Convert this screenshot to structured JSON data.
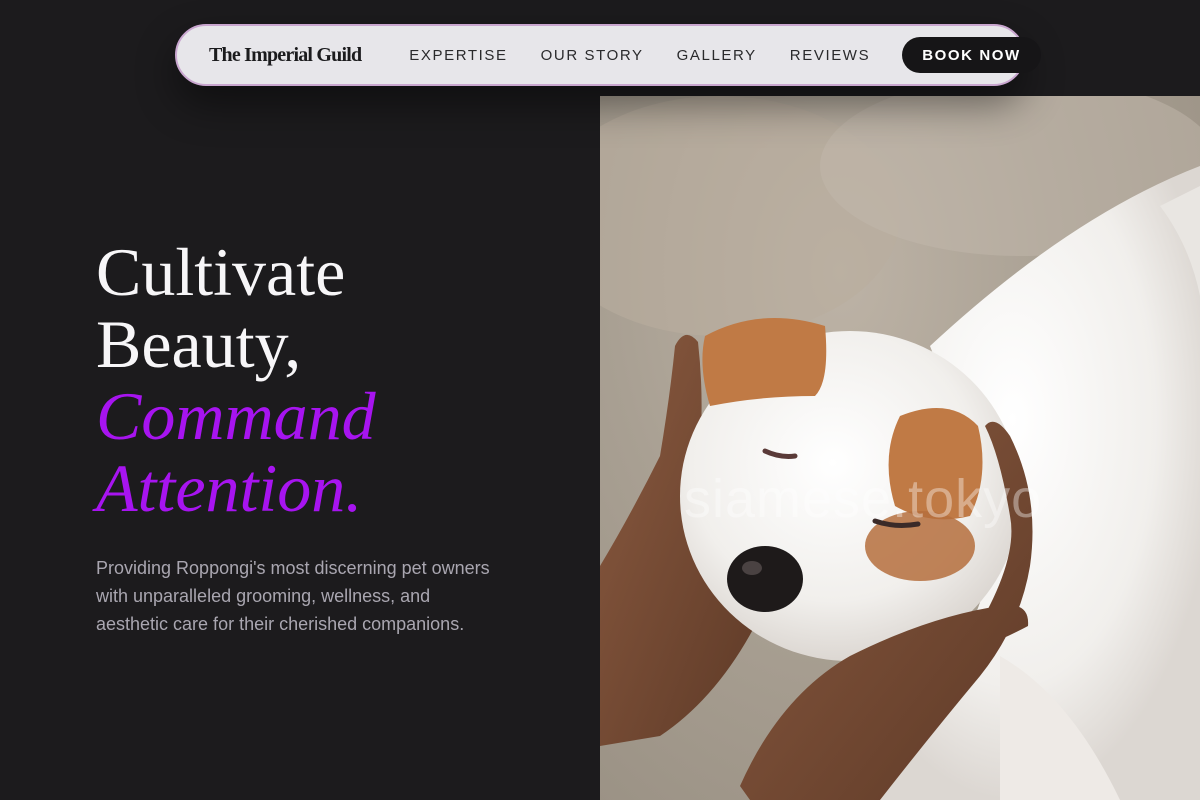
{
  "brand": {
    "name": "The Imperial Guild"
  },
  "nav": {
    "links": [
      {
        "label": "EXPERTISE"
      },
      {
        "label": "OUR STORY"
      },
      {
        "label": "GALLERY"
      },
      {
        "label": "REVIEWS"
      }
    ],
    "cta_label": "BOOK NOW"
  },
  "hero": {
    "headline_line1": "Cultivate",
    "headline_line2": "Beauty,",
    "headline_accent_line1": "Command",
    "headline_accent_line2": "Attention.",
    "subtext": "Providing Roppongi's most discerning pet owners with unparalleled grooming, wellness, and aesthetic care for their cherished companions.",
    "image_watermark": "siamese.tokyo"
  },
  "colors": {
    "background": "#1c1b1d",
    "nav_background": "#e7e6ea",
    "accent": "#a714f0",
    "body_text": "#a9a6b0"
  }
}
